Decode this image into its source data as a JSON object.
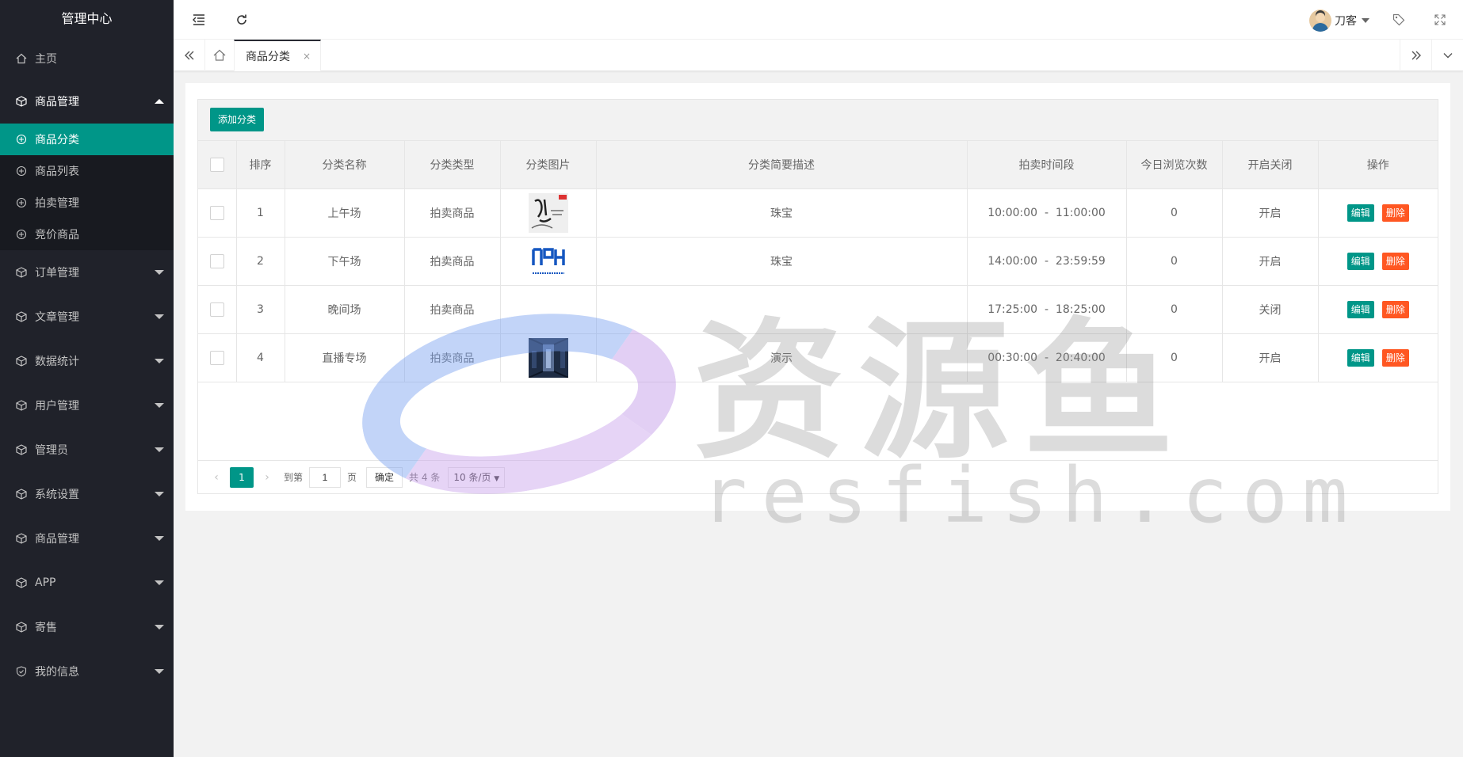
{
  "app": {
    "title": "管理中心"
  },
  "sidebar": {
    "home": "主页",
    "goods_group": "商品管理",
    "sub_items": [
      "商品分类",
      "商品列表",
      "拍卖管理",
      "竞价商品"
    ],
    "groups": [
      "订单管理",
      "文章管理",
      "数据统计",
      "用户管理",
      "管理员",
      "系统设置",
      "商品管理",
      "APP",
      "寄售",
      "我的信息"
    ]
  },
  "header": {
    "username": "刀客"
  },
  "tabs": {
    "active": "商品分类",
    "close": "×"
  },
  "toolbar": {
    "add_label": "添加分类"
  },
  "table": {
    "headers": [
      "排序",
      "分类名称",
      "分类类型",
      "分类图片",
      "分类简要描述",
      "拍卖时间段",
      "今日浏览次数",
      "开启关闭",
      "操作"
    ],
    "rows": [
      {
        "sort": "1",
        "name": "上午场",
        "type": "拍卖商品",
        "desc": "珠宝",
        "time": "10:00:00  -  11:00:00",
        "views": "0",
        "status": "开启",
        "image": "thumb-calligraphy"
      },
      {
        "sort": "2",
        "name": "下午场",
        "type": "拍卖商品",
        "desc": "珠宝",
        "time": "14:00:00  -  23:59:59",
        "views": "0",
        "status": "开启",
        "image": "thumb-logo-blue"
      },
      {
        "sort": "3",
        "name": "晚间场",
        "type": "拍卖商品",
        "desc": "",
        "time": "17:25:00  -  18:25:00",
        "views": "0",
        "status": "关闭",
        "image": ""
      },
      {
        "sort": "4",
        "name": "直播专场",
        "type": "拍卖商品",
        "desc": "演示",
        "time": "00:30:00  -  20:40:00",
        "views": "0",
        "status": "开启",
        "image": "thumb-corridor"
      }
    ],
    "edit_label": "编辑",
    "delete_label": "删除"
  },
  "pager": {
    "prev": "‹",
    "next": "›",
    "current": "1",
    "goto_label": "到第",
    "goto_value": "1",
    "page_suffix": "页",
    "confirm": "确定",
    "total": "共 4 条",
    "page_size": "10 条/页"
  },
  "watermark": {
    "cn": "资源鱼",
    "en": "resfish.com"
  },
  "colors": {
    "sidebar": "#20222a",
    "accent": "#009688",
    "danger": "#ff5722"
  }
}
